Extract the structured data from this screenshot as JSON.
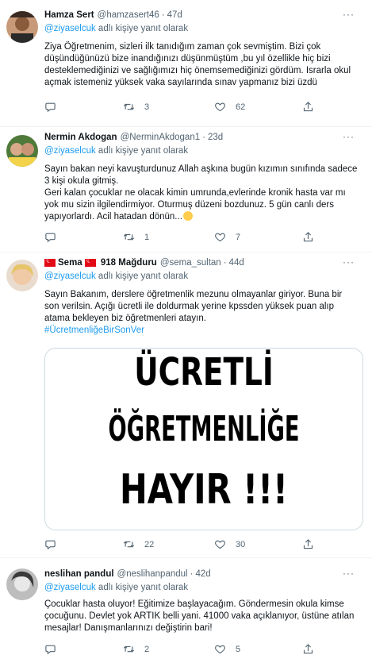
{
  "tweets": [
    {
      "name": "Hamza Sert",
      "handle": "@hamzasert46",
      "time": "47d",
      "reply_prefix": "@ziyaselcuk",
      "reply_suffix": " adlı kişiye yanıt olarak",
      "lines": [
        "Ziya Öğretmenim, sizleri ilk tanıdığım zaman çok sevmiştim. Bizi çok",
        "düşündüğünüzü bize inandığınızı düşünmüştüm ,bu yıl özellikle hiç bizi",
        "desteklemediğinizi ve sağlığımızı hiç önemsemediğinizi gördüm. Israrla okul",
        "açmak istemeniz yüksek vaka sayılarında sınav yapmanız bizi üzdü"
      ],
      "replies": "",
      "retweets": "3",
      "likes": "62"
    },
    {
      "name": "Nermin Akdogan",
      "handle": "@NerminAkdogan1",
      "time": "23d",
      "reply_prefix": "@ziyaselcuk",
      "reply_suffix": " adlı kişiye yanıt olarak",
      "lines": [
        "Sayın bakan neyi kavuşturdunuz Allah aşkına bugün kızımın sınıfında sadece",
        "3 kişi okula gitmiş.",
        "Geri kalan çocuklar ne olacak kimin umrunda,evlerinde kronik hasta var mı",
        "yok mu sizin ilgilendirmiyor. Oturmuş düzeni bozdunuz. 5 gün canlı ders",
        "yapıyorlardı. Acil hatadan dönün..."
      ],
      "replies": "",
      "retweets": "1",
      "likes": "7"
    },
    {
      "name_text": "Sema",
      "name_suffix": " 918 Mağduru",
      "handle": "@sema_sultan",
      "time": "44d",
      "reply_prefix": "@ziyaselcuk",
      "reply_suffix": " adlı kişiye yanıt olarak",
      "lines": [
        "Sayın Bakanım, derslere öğretmenlik mezunu olmayanlar giriyor. Buna bir",
        "son verilsin. Açığı ücretli ile doldurmak yerine kpssden yüksek puan alıp",
        "atama bekleyen biz öğretmenleri atayın."
      ],
      "hashtag": "#ÜcretmenliğeBirSonVer",
      "media_lines": [
        "ÜCRETLİ",
        "ÖĞRETMENLİĞE",
        "HAYIR !!!"
      ],
      "replies": "",
      "retweets": "22",
      "likes": "30"
    },
    {
      "name": "neslihan pandul",
      "handle": "@neslihanpandul",
      "time": "42d",
      "reply_prefix": "@ziyaselcuk",
      "reply_suffix": " adlı kişiye yanıt olarak",
      "lines": [
        "Çocuklar hasta oluyor! Eğitimize başlayacağım. Göndermesin okula kimse",
        "çocuğunu. Devlet yok ARTIK belli yani. 41000 vaka açıklanıyor, üstüne atılan",
        "mesajlar! Danışmanlarınızı değiştirin bari!"
      ],
      "replies": "",
      "retweets": "2",
      "likes": "5"
    }
  ],
  "colors": {
    "accent": "#1d9bf0",
    "muted": "#536471",
    "text": "#0f1419"
  },
  "icons": [
    "reply-icon",
    "retweet-icon",
    "like-icon",
    "share-icon",
    "more-icon"
  ]
}
